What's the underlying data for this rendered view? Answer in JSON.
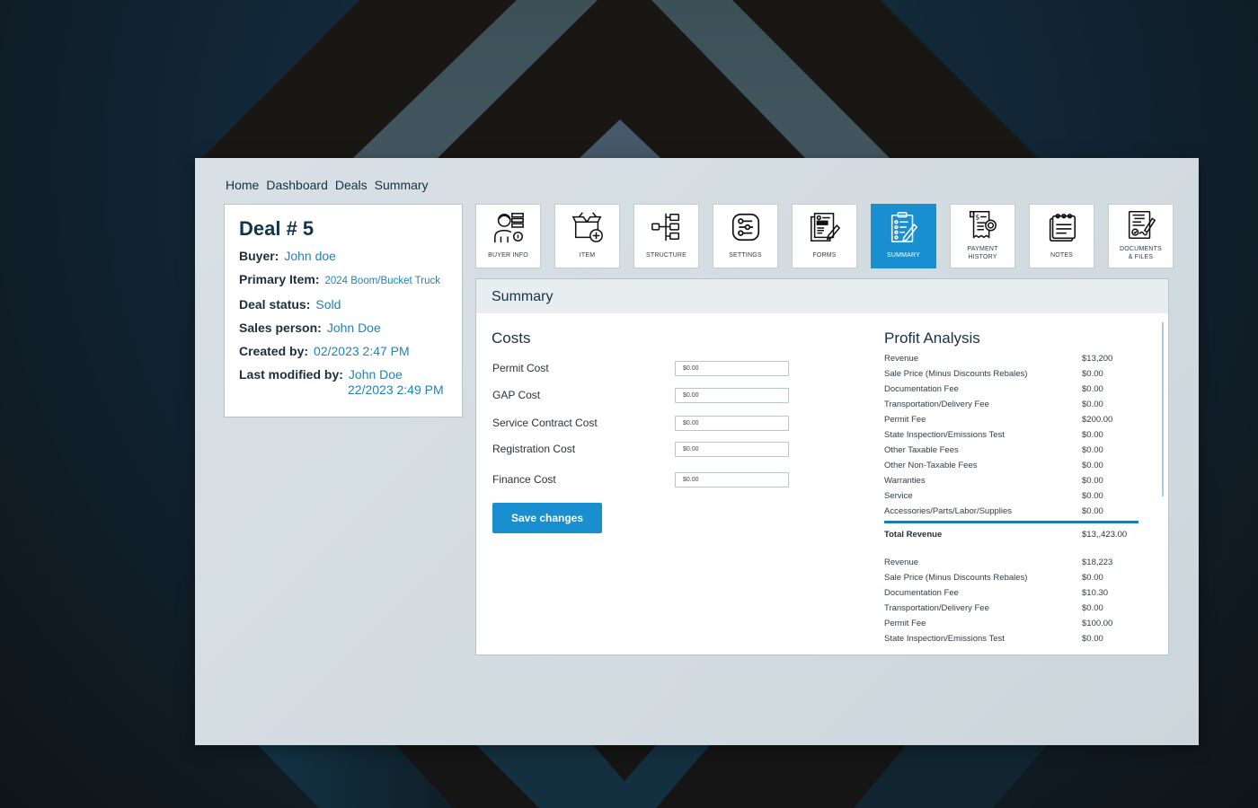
{
  "breadcrumb": [
    "Home",
    "Dashboard",
    "Deals",
    "Summary"
  ],
  "deal": {
    "title": "Deal # 5",
    "fields": [
      {
        "label": "Buyer:",
        "value": "John doe"
      },
      {
        "label": "Primary Item:",
        "value": "2024 Boom/Bucket Truck"
      },
      {
        "label": "Deal status:",
        "value": "Sold"
      },
      {
        "label": "Sales person:",
        "value": "John Doe"
      },
      {
        "label": "Created by:",
        "value": "02/2023 2:47 PM"
      },
      {
        "label": "Last modified by:",
        "value": "John Doe",
        "value2": "22/2023 2:49 PM"
      }
    ]
  },
  "tiles": [
    {
      "label": "BUYER INFO",
      "icon": "buyer-info-icon"
    },
    {
      "label": "ITEM",
      "icon": "item-box-icon"
    },
    {
      "label": "STRUCTURE",
      "icon": "structure-icon"
    },
    {
      "label": "SETTINGS",
      "icon": "settings-icon"
    },
    {
      "label": "FORMS",
      "icon": "forms-icon"
    },
    {
      "label": "SUMMARY",
      "icon": "summary-clipboard-icon",
      "active": true
    },
    {
      "label": "PAYMENT",
      "label2": "HISTORY",
      "icon": "payment-history-icon"
    },
    {
      "label": "NOTES",
      "icon": "notes-icon"
    },
    {
      "label": "DOCUMENTS",
      "label2": "& FILES",
      "icon": "documents-files-icon"
    }
  ],
  "panel": {
    "title": "Summary",
    "costs": {
      "title": "Costs",
      "rows": [
        {
          "label": "Permit Cost",
          "value": "$0.00"
        },
        {
          "label": "GAP Cost",
          "value": "$0.00"
        },
        {
          "label": "Service Contract Cost",
          "value": "$0.00"
        },
        {
          "label": "Registration Cost",
          "value": "$0.00"
        },
        {
          "label": "Finance Cost",
          "value": "$0.00"
        }
      ],
      "save_label": "Save changes"
    },
    "profit": {
      "title": "Profit Analysis",
      "group1": [
        {
          "name": "Revenue",
          "value": "$13,200"
        },
        {
          "name": "Sale Price (Minus Discounts Rebales)",
          "value": "$0.00"
        },
        {
          "name": "Documentation Fee",
          "value": "$0.00"
        },
        {
          "name": "Transportation/Delivery Fee",
          "value": "$0.00"
        },
        {
          "name": "Permit Fee",
          "value": "$200.00"
        },
        {
          "name": "State Inspection/Emissions Test",
          "value": "$0.00"
        },
        {
          "name": "Other Taxable Fees",
          "value": "$0.00"
        },
        {
          "name": "Other Non-Taxable Fees",
          "value": "$0.00"
        },
        {
          "name": "Warranties",
          "value": "$0.00"
        },
        {
          "name": "Service",
          "value": "$0.00"
        },
        {
          "name": "Accessories/Parts/Labor/Supplies",
          "value": "$0.00"
        }
      ],
      "total": {
        "name": "Total Revenue",
        "value": "$13,,423.00"
      },
      "group2": [
        {
          "name": "Revenue",
          "value": "$18,223"
        },
        {
          "name": "Sale Price (Minus Discounts Rebales)",
          "value": "$0.00"
        },
        {
          "name": "Documentation Fee",
          "value": "$10.30"
        },
        {
          "name": "Transportation/Delivery Fee",
          "value": "$0.00"
        },
        {
          "name": "Permit Fee",
          "value": "$100.00"
        },
        {
          "name": "State Inspection/Emissions Test",
          "value": "$0.00"
        }
      ]
    }
  }
}
